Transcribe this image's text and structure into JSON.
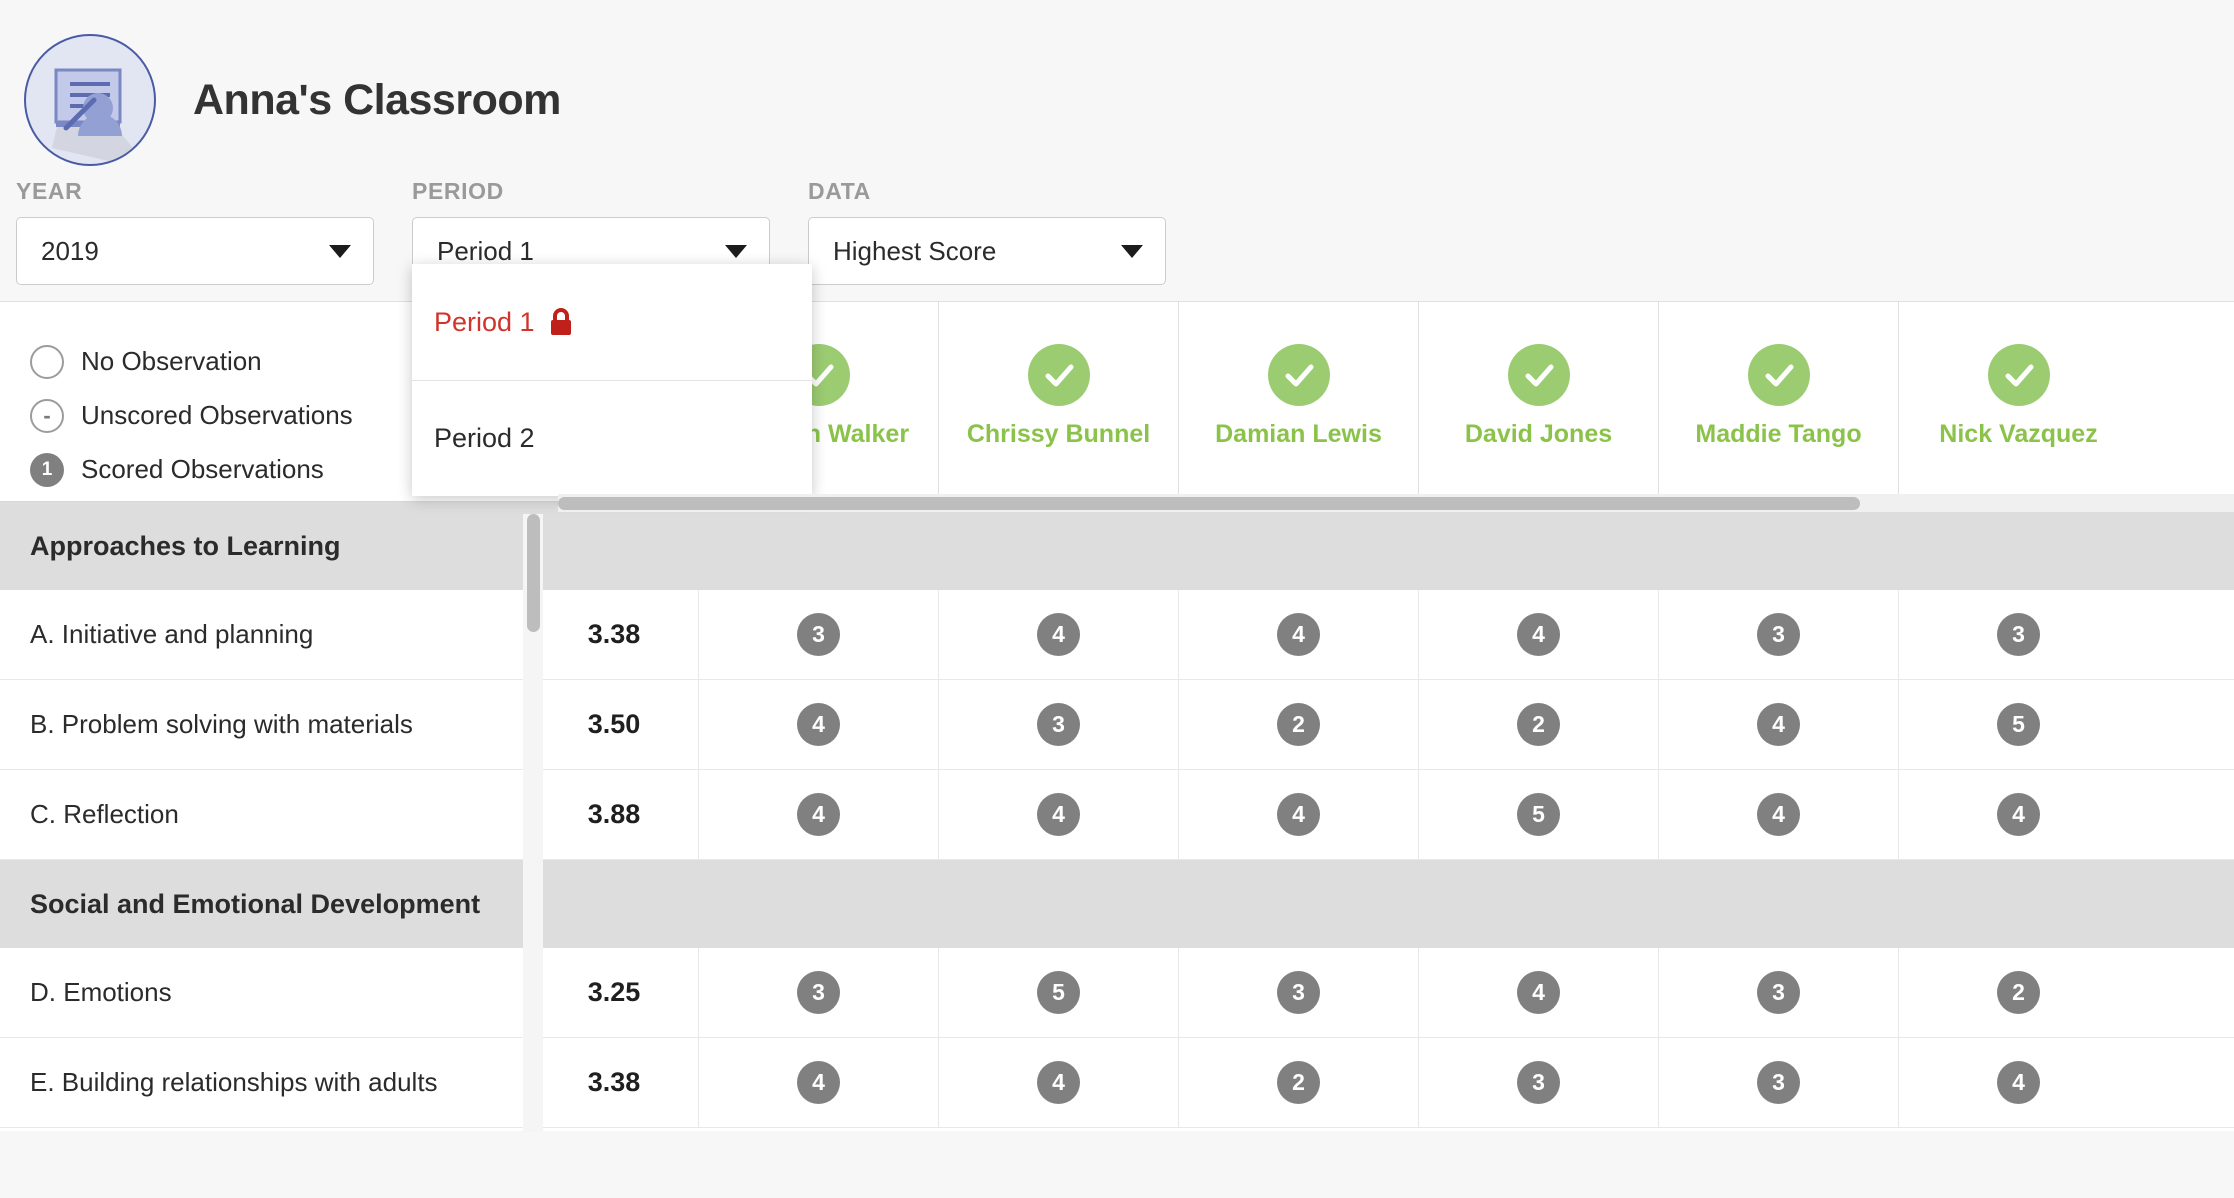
{
  "header": {
    "title": "Anna's Classroom",
    "avatar_icon": "classroom-presentation-icon"
  },
  "filters": [
    {
      "label": "YEAR",
      "value": "2019",
      "name": "year"
    },
    {
      "label": "PERIOD",
      "value": "Period 1",
      "name": "period"
    },
    {
      "label": "DATA",
      "value": "Highest Score",
      "name": "data"
    }
  ],
  "period_dropdown": {
    "open": true,
    "items": [
      {
        "label": "Period 1",
        "locked": true,
        "lock_icon": "lock-icon"
      },
      {
        "label": "Period 2",
        "locked": false
      }
    ]
  },
  "legend": [
    {
      "marker": "empty-circle",
      "label": "No Observation"
    },
    {
      "marker": "dash-circle",
      "label": "Unscored Observations",
      "symbol": "-"
    },
    {
      "marker": "filled-circle",
      "label": "Scored Observations",
      "symbol": "1"
    }
  ],
  "students": [
    {
      "name": "Carmen Walker",
      "status_icon": "check-circle-icon"
    },
    {
      "name": "Chrissy Bunnel",
      "status_icon": "check-circle-icon"
    },
    {
      "name": "Damian Lewis",
      "status_icon": "check-circle-icon"
    },
    {
      "name": "David Jones",
      "status_icon": "check-circle-icon"
    },
    {
      "name": "Maddie Tango",
      "status_icon": "check-circle-icon"
    },
    {
      "name": "Nick Vazquez",
      "status_icon": "check-circle-icon"
    }
  ],
  "colors": {
    "student_green": "#8bc34a",
    "check_badge_green": "#9ccc72",
    "score_badge_gray": "#808080",
    "locked_red": "#d0342c",
    "section_band": "#dddddd"
  },
  "table": {
    "sections": [
      {
        "title": "Approaches to Learning",
        "rows": [
          {
            "label": "A. Initiative and planning",
            "average": "3.38",
            "scores": [
              "3",
              "4",
              "4",
              "4",
              "3",
              "3"
            ]
          },
          {
            "label": "B. Problem solving with materials",
            "average": "3.50",
            "scores": [
              "4",
              "3",
              "2",
              "2",
              "4",
              "5"
            ]
          },
          {
            "label": "C. Reflection",
            "average": "3.88",
            "scores": [
              "4",
              "4",
              "4",
              "5",
              "4",
              "4"
            ]
          }
        ]
      },
      {
        "title": "Social and Emotional Development",
        "rows": [
          {
            "label": "D. Emotions",
            "average": "3.25",
            "scores": [
              "3",
              "5",
              "3",
              "4",
              "3",
              "2"
            ]
          },
          {
            "label": "E. Building relationships with adults",
            "average": "3.38",
            "scores": [
              "4",
              "4",
              "2",
              "3",
              "3",
              "4"
            ]
          }
        ]
      }
    ]
  },
  "scrollbars": {
    "horizontal": "horizontal-scrollbar",
    "vertical": "vertical-scrollbar"
  }
}
